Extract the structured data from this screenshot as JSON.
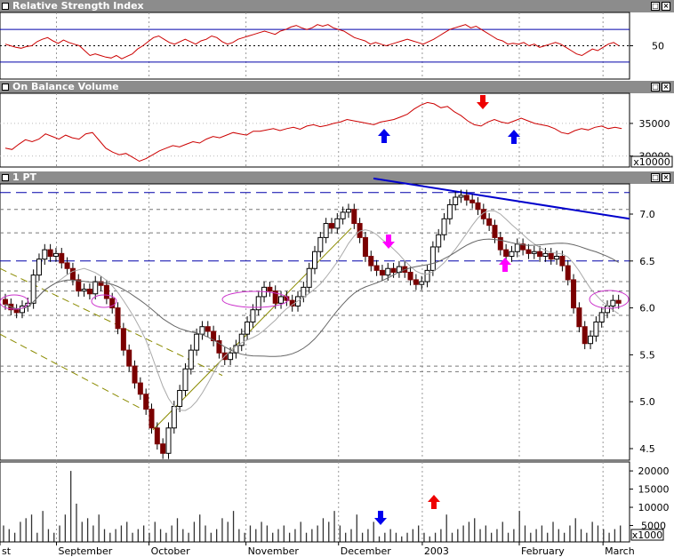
{
  "panels": {
    "rsi": {
      "title": "Relative Strength Index",
      "y_ticks": [
        {
          "label": "50",
          "value": 50
        }
      ]
    },
    "obv": {
      "title": "On Balance Volume",
      "y_ticks": [
        {
          "label": "35000",
          "value": 35000
        },
        {
          "label": "30000",
          "value": 30000
        }
      ],
      "multiplier": "x10000"
    },
    "price": {
      "title": "1 PT",
      "y_ticks": [
        {
          "label": "7.0",
          "value": 7.0
        },
        {
          "label": "6.5",
          "value": 6.5
        },
        {
          "label": "6.0",
          "value": 6.0
        },
        {
          "label": "5.5",
          "value": 5.5
        },
        {
          "label": "5.0",
          "value": 5.0
        },
        {
          "label": "4.5",
          "value": 4.5
        }
      ]
    },
    "volume": {
      "y_ticks": [
        {
          "label": "20000",
          "value": 20000
        },
        {
          "label": "15000",
          "value": 15000
        },
        {
          "label": "10000",
          "value": 10000
        },
        {
          "label": "5000",
          "value": 5000
        }
      ],
      "multiplier": "x1000"
    }
  },
  "x_labels": [
    {
      "label": "st",
      "bar": 0
    },
    {
      "label": "September",
      "bar": 12
    },
    {
      "label": "October",
      "bar": 33
    },
    {
      "label": "November",
      "bar": 55
    },
    {
      "label": "December",
      "bar": 76
    },
    {
      "label": "2003",
      "bar": 95
    },
    {
      "label": "February",
      "bar": 117
    },
    {
      "label": "March",
      "bar": 136
    }
  ],
  "window_buttons": {
    "minimize": "–",
    "maximize": "□",
    "close": "×"
  },
  "colors": {
    "up": "#ffffff",
    "down": "#7a0000",
    "rsi": "#cc0000",
    "ma_short": "#aaaaaa",
    "ma_long": "#666666",
    "trend_blue": "#0000cc",
    "trend_olive": "#8b8b00",
    "oval": "#cc33cc",
    "arrow_blue": "#0000ee",
    "arrow_red": "#ee0000",
    "arrow_magenta": "#ff00ff"
  },
  "chart_data": [
    {
      "type": "line",
      "name": "Relative Strength Index",
      "y": [
        52,
        50,
        48,
        47,
        49,
        50,
        55,
        58,
        60,
        56,
        53,
        57,
        54,
        52,
        50,
        44,
        38,
        40,
        38,
        36,
        35,
        38,
        34,
        37,
        40,
        46,
        50,
        55,
        60,
        62,
        58,
        54,
        52,
        55,
        58,
        55,
        52,
        56,
        58,
        62,
        60,
        55,
        52,
        54,
        58,
        60,
        62,
        64,
        66,
        68,
        66,
        64,
        68,
        70,
        73,
        75,
        72,
        70,
        72,
        76,
        74,
        76,
        72,
        70,
        68,
        64,
        60,
        58,
        56,
        52,
        54,
        52,
        50,
        52,
        54,
        56,
        58,
        56,
        54,
        52,
        55,
        58,
        62,
        66,
        70,
        72,
        74,
        76,
        72,
        74,
        70,
        66,
        62,
        58,
        56,
        52,
        53,
        52,
        54,
        50,
        52,
        48,
        50,
        52,
        54,
        52,
        48,
        44,
        40,
        38,
        42,
        46,
        44,
        48,
        52,
        54,
        50
      ]
    },
    {
      "type": "line",
      "name": "On Balance Volume",
      "y": [
        31200,
        31000,
        31800,
        32500,
        32200,
        32600,
        33400,
        33000,
        32600,
        33200,
        32800,
        32600,
        33400,
        33600,
        32400,
        31200,
        30600,
        30200,
        30400,
        29800,
        29200,
        29600,
        30200,
        30800,
        31200,
        31600,
        31400,
        31800,
        32200,
        32000,
        32600,
        33000,
        32800,
        33200,
        33600,
        33400,
        33200,
        33800,
        33800,
        34000,
        34200,
        33900,
        34200,
        34400,
        34100,
        34600,
        34800,
        34500,
        34700,
        35000,
        35200,
        35600,
        35400,
        35200,
        35000,
        34800,
        35200,
        35400,
        35600,
        36000,
        36400,
        37200,
        37800,
        38200,
        38000,
        37400,
        37600,
        36800,
        36200,
        35400,
        34800,
        34600,
        35200,
        35600,
        35200,
        35000,
        35400,
        35800,
        35400,
        35000,
        34800,
        34600,
        34200,
        33600,
        33400,
        33900,
        34200,
        34000,
        34400,
        34600,
        34200,
        34400,
        34200
      ],
      "arrows": [
        {
          "bar": 74,
          "dir": "up",
          "color": "blue"
        },
        {
          "bar": 94,
          "dir": "down",
          "color": "red"
        },
        {
          "bar": 99,
          "dir": "up",
          "color": "blue"
        }
      ]
    },
    {
      "type": "candlestick",
      "name": "1 PT",
      "close": [
        6.04,
        5.98,
        5.95,
        6.02,
        6.05,
        6.35,
        6.52,
        6.62,
        6.55,
        6.58,
        6.48,
        6.42,
        6.3,
        6.18,
        6.2,
        6.15,
        6.28,
        6.24,
        6.1,
        6.0,
        5.78,
        5.55,
        5.38,
        5.2,
        5.08,
        4.92,
        4.72,
        4.55,
        4.45,
        4.72,
        4.95,
        5.12,
        5.35,
        5.55,
        5.72,
        5.8,
        5.75,
        5.65,
        5.52,
        5.45,
        5.52,
        5.6,
        5.72,
        5.85,
        5.98,
        6.12,
        6.22,
        6.18,
        6.05,
        6.12,
        6.08,
        6.02,
        6.12,
        6.22,
        6.42,
        6.6,
        6.75,
        6.9,
        6.85,
        6.95,
        7.02,
        7.05,
        6.9,
        6.75,
        6.55,
        6.45,
        6.4,
        6.35,
        6.42,
        6.38,
        6.44,
        6.38,
        6.3,
        6.25,
        6.28,
        6.4,
        6.65,
        6.78,
        6.95,
        7.1,
        7.18,
        7.2,
        7.15,
        7.12,
        7.05,
        6.95,
        6.88,
        6.75,
        6.62,
        6.55,
        6.6,
        6.68,
        6.62,
        6.58,
        6.6,
        6.55,
        6.58,
        6.52,
        6.55,
        6.45,
        6.3,
        6.0,
        5.8,
        5.62,
        5.7,
        5.85,
        5.95,
        6.02,
        6.08,
        6.05
      ],
      "ma_short_note": "thin light grey moving average",
      "ma_long_note": "thin dark grey moving average"
    },
    {
      "type": "bar",
      "name": "Volume",
      "y": [
        5,
        4,
        3,
        6,
        7,
        8,
        3,
        9,
        4,
        3,
        5,
        8,
        20,
        11,
        6,
        7,
        5,
        8,
        4,
        3,
        4,
        5,
        6,
        3,
        4,
        5,
        3,
        6,
        4,
        3,
        5,
        7,
        4,
        3,
        6,
        8,
        5,
        3,
        4,
        7,
        6,
        9,
        4,
        3,
        5,
        4,
        6,
        5,
        3,
        4,
        5,
        3,
        4,
        6,
        3,
        4,
        5,
        7,
        6,
        9,
        5,
        3,
        4,
        8,
        3,
        4,
        6,
        2,
        3,
        4,
        3,
        2,
        3,
        4,
        5,
        3,
        2,
        3,
        4,
        8,
        3,
        4,
        5,
        6,
        7,
        4,
        5,
        3,
        4,
        6,
        3,
        4,
        9,
        5,
        3,
        4,
        5,
        3,
        6,
        4,
        3,
        5,
        7,
        4,
        3,
        6,
        5,
        4,
        3,
        4,
        5
      ],
      "arrows": [
        {
          "bar": 74,
          "dir": "down",
          "color": "blue"
        },
        {
          "bar": 88,
          "dir": "up",
          "color": "red"
        }
      ]
    }
  ]
}
